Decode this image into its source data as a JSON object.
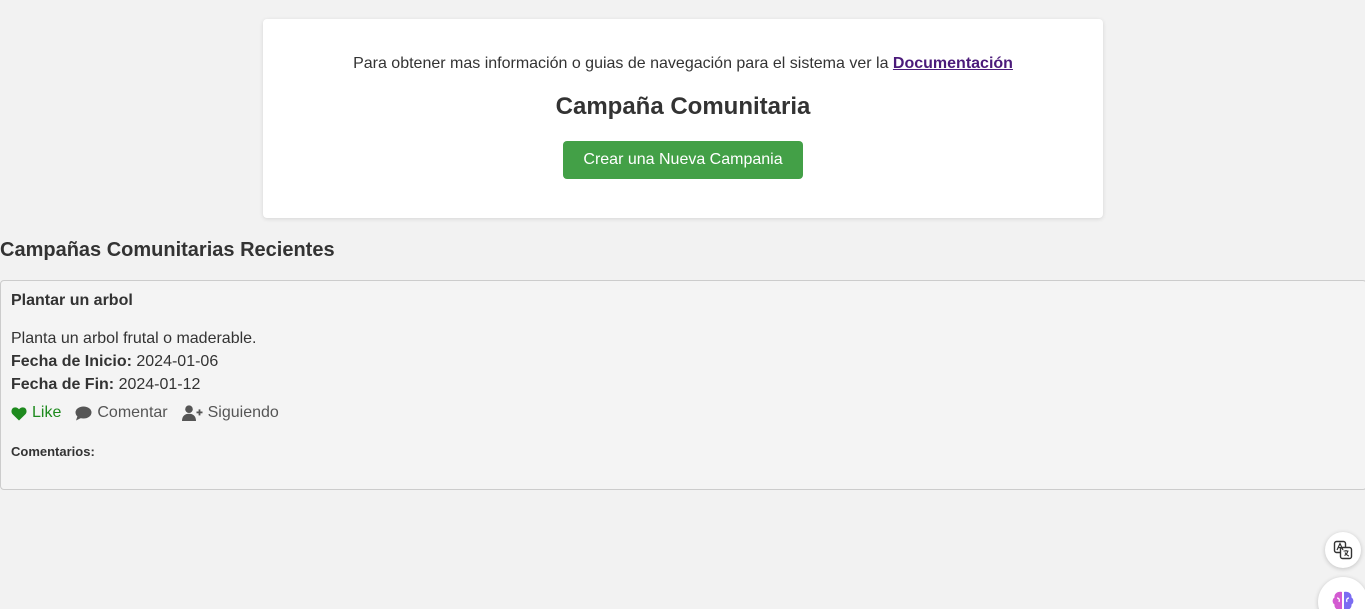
{
  "header": {
    "doc_prefix": "Para obtener mas información o guias de navegación para el sistema ver la",
    "doc_link": "Documentación",
    "title": "Campaña Comunitaria",
    "new_button": "Crear una Nueva Campania"
  },
  "recent": {
    "title": "Campañas Comunitarias Recientes"
  },
  "campaign": {
    "title": "Plantar un arbol",
    "description": "Planta un arbol frutal o maderable.",
    "start_label": "Fecha de Inicio:",
    "start_value": "2024-01-06",
    "end_label": "Fecha de Fin:",
    "end_value": "2024-01-12",
    "actions": {
      "like": "Like",
      "comment": "Comentar",
      "follow": "Siguiendo"
    },
    "comments_label": "Comentarios:"
  },
  "icons": {
    "like": "heart-icon",
    "comment": "comment-icon",
    "follow": "user-plus-icon",
    "translate": "translate-icon",
    "assistant": "brain-icon"
  },
  "colors": {
    "button": "#43a047",
    "like": "#1e8a1e",
    "link": "#4b1a7a"
  }
}
